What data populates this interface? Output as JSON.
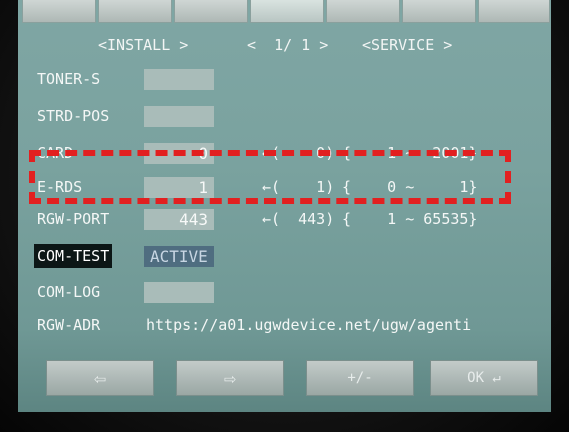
{
  "nav": {
    "install": "<INSTALL >",
    "page": "<  1/ 1 >",
    "service": "<SERVICE >"
  },
  "rows": [
    {
      "label": "TONER-S"
    },
    {
      "label": "STRD-POS"
    },
    {
      "label": "CARD",
      "value": "0",
      "default": "←(    0)",
      "range": "{    1 ~  2001}"
    },
    {
      "label": "E-RDS",
      "value": "1",
      "default": "←(    1)",
      "range": "{    0 ~     1}"
    },
    {
      "label": "RGW-PORT",
      "value": "443",
      "default": "←(  443)",
      "range": "{    1 ~ 65535}"
    },
    {
      "label": "COM-TEST",
      "value": "ACTIVE"
    },
    {
      "label": "COM-LOG"
    },
    {
      "label": "RGW-ADR",
      "value": "https://a01.ugwdevice.net/ugw/agenti"
    }
  ],
  "buttons": {
    "back": "⇦",
    "forward": "⇨",
    "plusminus": "+/-",
    "ok": "OK ↵"
  },
  "colors": {
    "screen": "#7aa29f",
    "highlight": "#e22020",
    "active_box": "#4f6d80"
  }
}
